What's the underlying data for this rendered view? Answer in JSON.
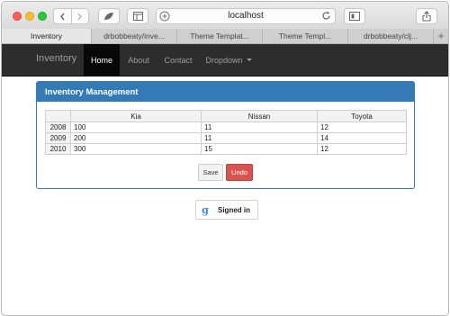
{
  "browser": {
    "url": "localhost",
    "tabs": [
      {
        "label": "Inventory",
        "active": true
      },
      {
        "label": "drbobbeaty/inve...",
        "active": false
      },
      {
        "label": "Theme Templat...",
        "active": false
      },
      {
        "label": "Theme Templ...",
        "active": false
      },
      {
        "label": "drbobbeaty/clj...",
        "active": false
      }
    ],
    "new_tab_label": "+"
  },
  "navbar": {
    "brand": "Inventory",
    "links": [
      "Home",
      "About",
      "Contact",
      "Dropdown"
    ],
    "active_link": "Home",
    "bg_color": "#2d2d2d"
  },
  "panel": {
    "title": "Inventory Management",
    "accent": "#337ab7",
    "table": {
      "columns": [
        "",
        "Kia",
        "Nissan",
        "Toyota"
      ],
      "rows": [
        [
          "2008",
          "100",
          "11",
          "12"
        ],
        [
          "2009",
          "200",
          "11",
          "14"
        ],
        [
          "2010",
          "300",
          "15",
          "12"
        ]
      ]
    },
    "buttons": {
      "save": "Save",
      "undo": "Undo",
      "undo_color": "#d9534f"
    }
  },
  "signin": {
    "icon": "google-g-icon",
    "glyph": "g",
    "label": "Signed in"
  }
}
